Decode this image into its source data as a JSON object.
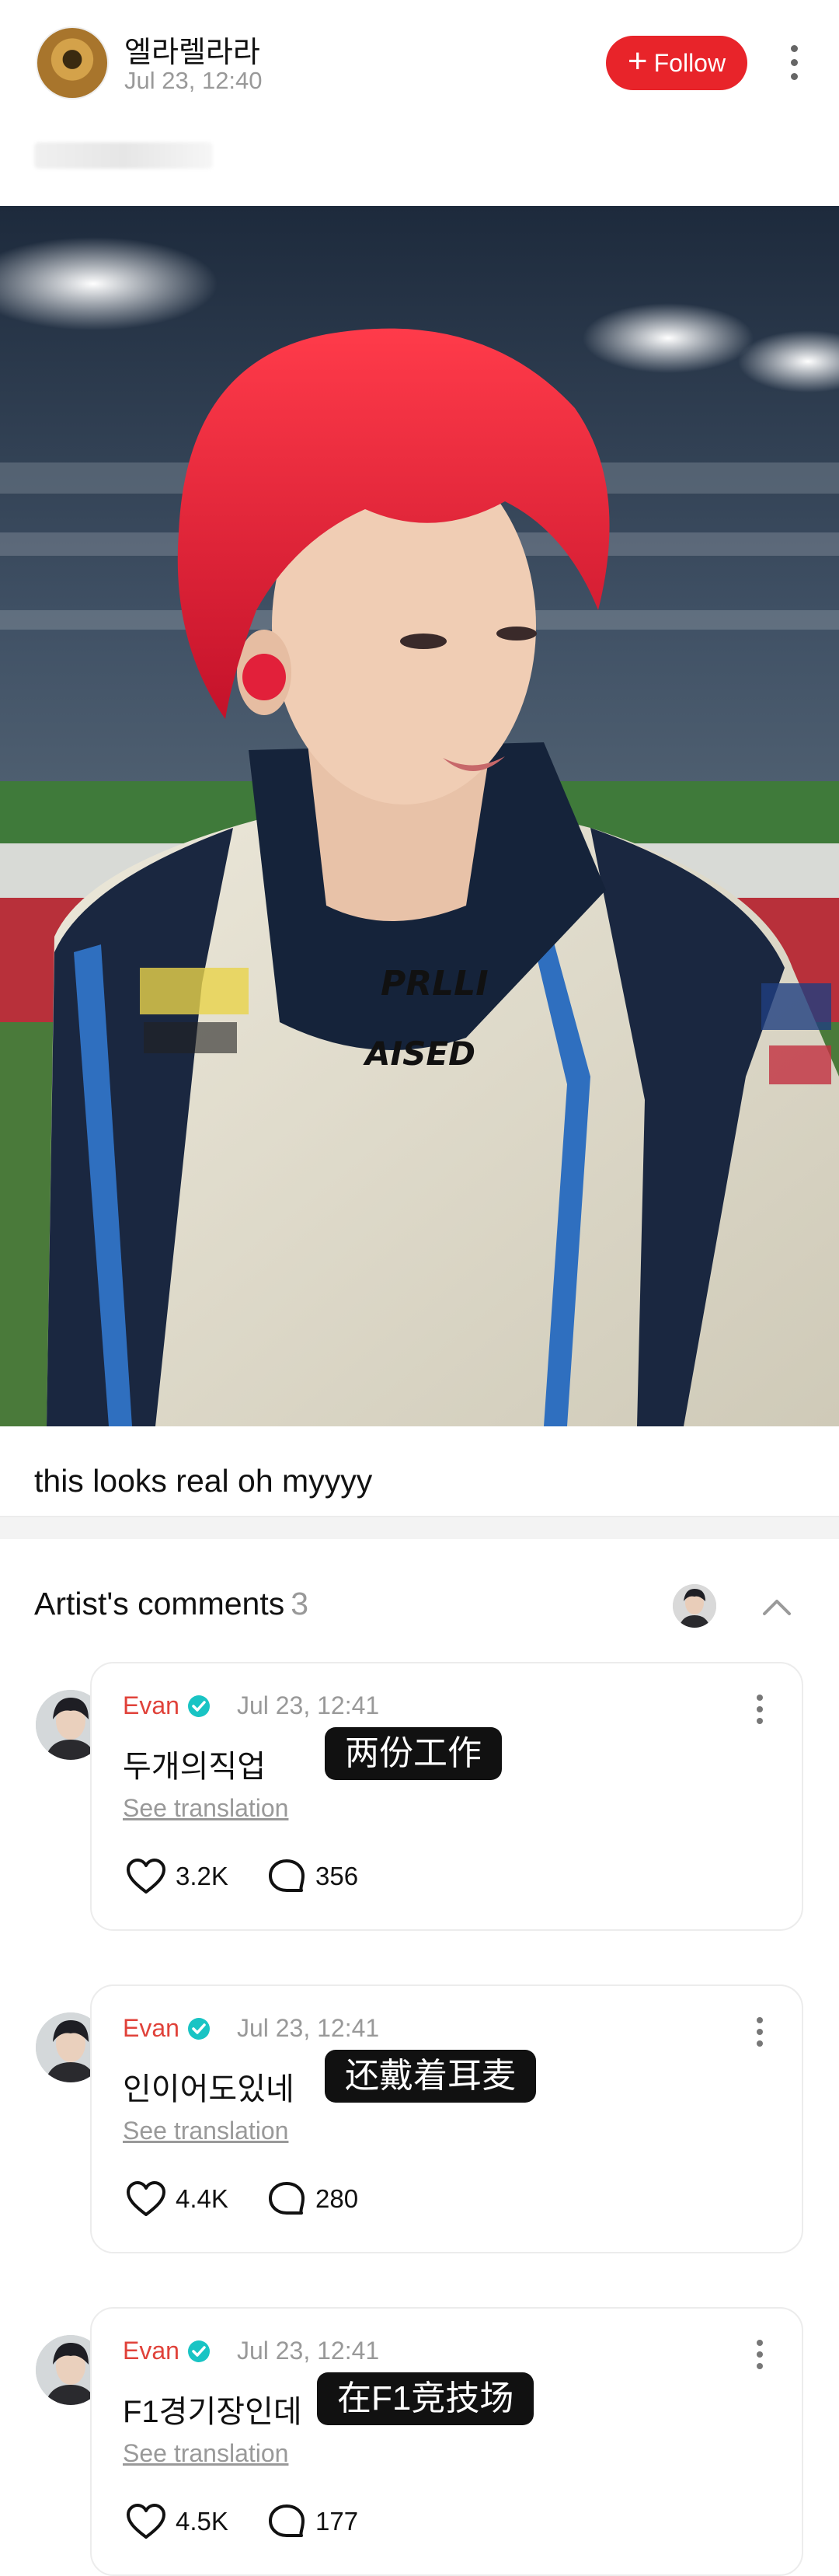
{
  "post": {
    "username": "엘라렐라라",
    "time": "Jul 23, 12:40",
    "follow_label": "Follow",
    "caption": "this looks real oh myyyy"
  },
  "artist_comments": {
    "title": "Artist's comments",
    "count": "3"
  },
  "comments": [
    {
      "name": "Evan",
      "time": "Jul 23, 12:41",
      "text": "두개의직업",
      "translation_badge": "两份工作",
      "see_translation": "See translation",
      "likes": "3.2K",
      "replies": "356"
    },
    {
      "name": "Evan",
      "time": "Jul 23, 12:41",
      "text": "인이어도있네",
      "translation_badge": "还戴着耳麦",
      "see_translation": "See translation",
      "likes": "4.4K",
      "replies": "280"
    },
    {
      "name": "Evan",
      "time": "Jul 23, 12:41",
      "text": "F1경기장인데",
      "translation_badge": "在F1竞技场",
      "see_translation": "See translation",
      "likes": "4.5K",
      "replies": "177"
    }
  ],
  "colors": {
    "follow": "#e8242a",
    "artist_name": "#e0423a",
    "verified": "#19c4c4"
  }
}
